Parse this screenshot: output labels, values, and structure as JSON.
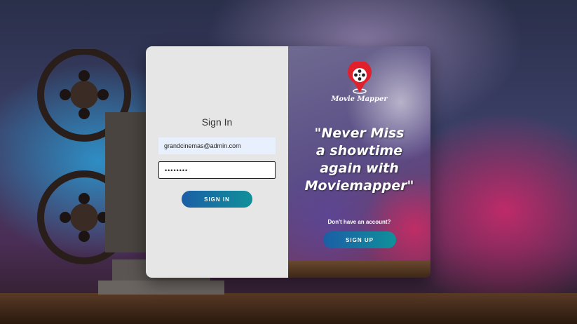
{
  "login": {
    "title": "Sign In",
    "email_value": "grandcinemas@admin.com",
    "password_value": "••••••••",
    "signin_label": "SIGN IN"
  },
  "promo": {
    "brand": "Movie Mapper",
    "quote_lines": [
      "\"Never Miss",
      "a showtime",
      "again with",
      "Moviemapper\""
    ],
    "no_account": "Don't have an account?",
    "signup_label": "SIGN UP"
  },
  "colors": {
    "button_start": "#1b5ea6",
    "button_end": "#10909a",
    "logo_red": "#e0202a",
    "left_panel": "#e6e6e6"
  },
  "icons": {
    "logo": "film-reel-pin-icon"
  }
}
